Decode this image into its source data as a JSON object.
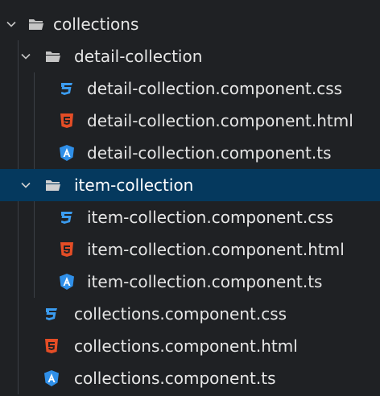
{
  "explorer": {
    "tree": [
      {
        "label": "collections",
        "kind": "folder",
        "expanded": true,
        "depth": 0,
        "selected": false
      },
      {
        "label": "detail-collection",
        "kind": "folder",
        "expanded": true,
        "depth": 1,
        "selected": false
      },
      {
        "label": "detail-collection.component.css",
        "kind": "css",
        "depth": 2,
        "selected": false
      },
      {
        "label": "detail-collection.component.html",
        "kind": "html",
        "depth": 2,
        "selected": false
      },
      {
        "label": "detail-collection.component.ts",
        "kind": "angular",
        "depth": 2,
        "selected": false
      },
      {
        "label": "item-collection",
        "kind": "folder",
        "expanded": true,
        "depth": 1,
        "selected": true
      },
      {
        "label": "item-collection.component.css",
        "kind": "css",
        "depth": 2,
        "selected": false
      },
      {
        "label": "item-collection.component.html",
        "kind": "html",
        "depth": 2,
        "selected": false
      },
      {
        "label": "item-collection.component.ts",
        "kind": "angular",
        "depth": 2,
        "selected": false
      },
      {
        "label": "collections.component.css",
        "kind": "css",
        "depth": 1,
        "selected": false
      },
      {
        "label": "collections.component.html",
        "kind": "html",
        "depth": 1,
        "selected": false
      },
      {
        "label": "collections.component.ts",
        "kind": "angular",
        "depth": 1,
        "selected": false
      }
    ],
    "icons": {
      "chevron": "chevron-down-icon",
      "folder": "folder-open-icon",
      "css": "css3-icon",
      "html": "html5-icon",
      "angular": "angular-icon"
    },
    "colors": {
      "background": "#1f2124",
      "selected_row": "#05395e",
      "text": "#e6e6e6",
      "css_icon": "#3b9cf0",
      "html_icon": "#e44d26",
      "angular_icon": "#2f8fe8",
      "folder_icon": "#c5c5c5"
    }
  }
}
